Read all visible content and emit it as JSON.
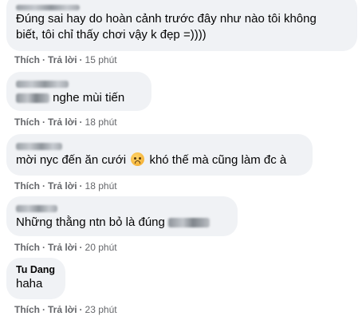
{
  "actions": {
    "like": "Thích",
    "reply": "Trả lời",
    "separator": "·"
  },
  "comments": [
    {
      "author_visible": false,
      "text": [
        "Đúng sai hay do hoàn cảnh trước đây như nào tôi không",
        "biết, tôi chỉ thấy chơi vậy k đẹp =))))"
      ],
      "time": "15 phút"
    },
    {
      "author_visible": false,
      "text": [
        "nghe mùi tiến"
      ],
      "time": "18 phút"
    },
    {
      "author_visible": false,
      "text": [
        "mời nyc đến ăn cưới",
        "khó thế mà cũng làm đc à"
      ],
      "emoji": "sad-face-icon",
      "time": "18 phút"
    },
    {
      "author_visible": false,
      "text": [
        "Những thằng ntn bỏ là đúng"
      ],
      "time": "20 phút"
    },
    {
      "author": "Tu Dang",
      "text": [
        "haha"
      ],
      "time": "23 phút"
    }
  ]
}
